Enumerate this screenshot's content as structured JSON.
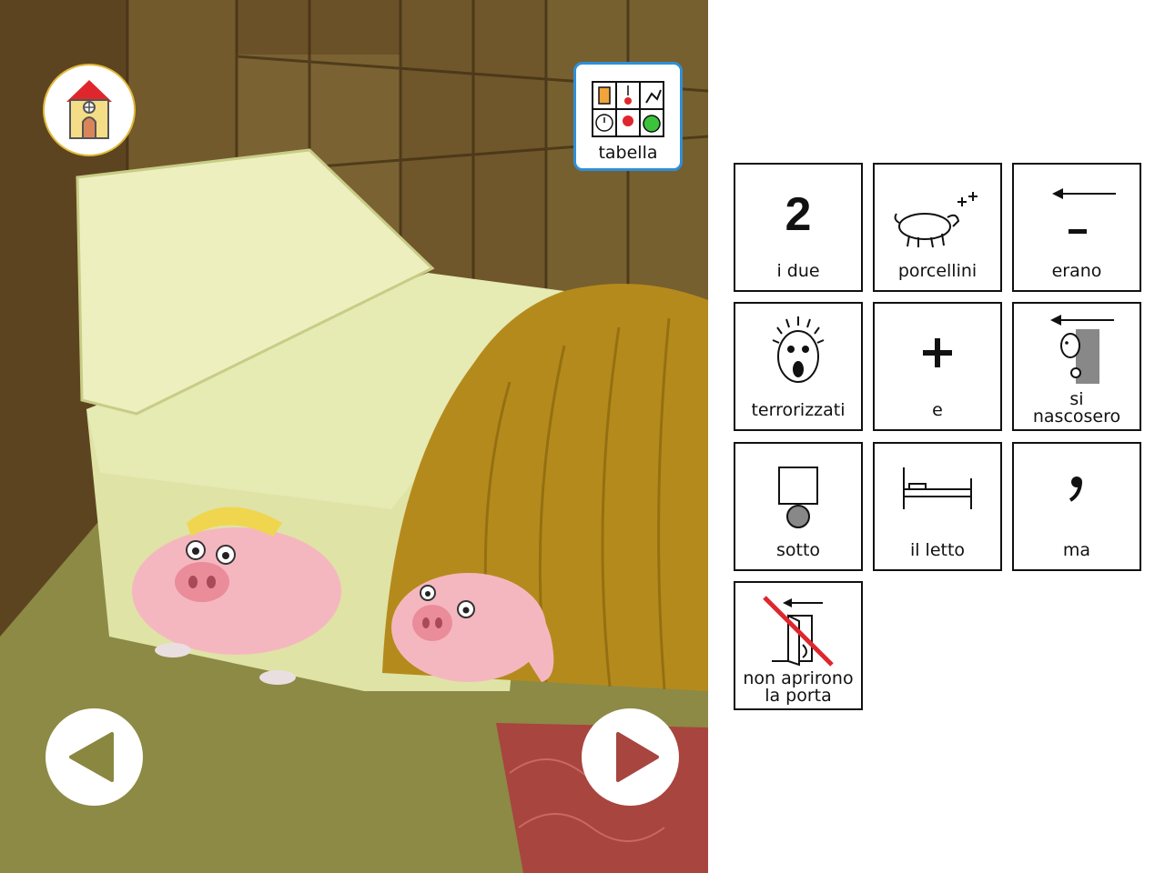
{
  "toolbar": {
    "tabella_label": "tabella"
  },
  "navigation": {
    "home_icon": "house-icon",
    "prev_icon": "triangle-left-icon",
    "next_icon": "triangle-right-icon"
  },
  "colors": {
    "wall": "#6b5128",
    "floor": "#8c8a45",
    "sheet": "#e4e8b0",
    "blanket": "#b58a1c",
    "rug": "#a8453f",
    "pig": "#f5b7bf",
    "frame_blue": "#2f8fd8"
  },
  "symbols": [
    {
      "label": "i due",
      "icon": "number-2-symbol"
    },
    {
      "label": "porcellini",
      "icon": "pig-plural-symbol"
    },
    {
      "label": "erano",
      "icon": "past-tense-verb-symbol"
    },
    {
      "label": "terrorizzati",
      "icon": "terrified-face-symbol"
    },
    {
      "label": "e",
      "icon": "plus-symbol"
    },
    {
      "label_line1": "si",
      "label_line2": "nascosero",
      "icon": "hiding-person-symbol"
    },
    {
      "label": "sotto",
      "icon": "under-symbol"
    },
    {
      "label": "il letto",
      "icon": "bed-symbol"
    },
    {
      "label": "ma",
      "icon": "comma-symbol"
    },
    {
      "label_line1": "non aprirono",
      "label_line2": "la porta",
      "icon": "not-open-door-symbol"
    }
  ]
}
